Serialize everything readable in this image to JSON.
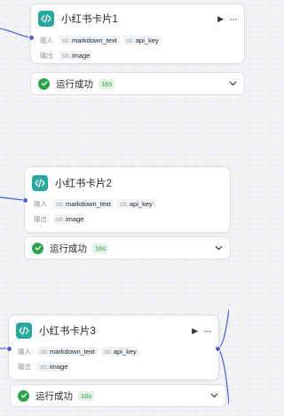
{
  "nodes": [
    {
      "title": "小红书卡片1",
      "input_label": "输入",
      "output_label": "输出",
      "inputs": [
        {
          "type": "str.",
          "name": "markdown_text"
        },
        {
          "type": "str.",
          "name": "api_key"
        }
      ],
      "outputs": [
        {
          "type": "str.",
          "name": "image"
        }
      ],
      "status": "运行成功",
      "duration": "16s"
    },
    {
      "title": "小红书卡片2",
      "input_label": "输入",
      "output_label": "输出",
      "inputs": [
        {
          "type": "str.",
          "name": "markdown_text"
        },
        {
          "type": "str.",
          "name": "api_key"
        }
      ],
      "outputs": [
        {
          "type": "str.",
          "name": "image"
        }
      ],
      "status": "运行成功",
      "duration": "16s"
    },
    {
      "title": "小红书卡片3",
      "input_label": "输入",
      "output_label": "输出",
      "inputs": [
        {
          "type": "str.",
          "name": "markdown_text"
        },
        {
          "type": "str.",
          "name": "api_key"
        }
      ],
      "outputs": [
        {
          "type": "str.",
          "name": "image"
        }
      ],
      "status": "运行成功",
      "duration": "16s"
    }
  ],
  "colors": {
    "accent": "#27a7a0",
    "edge": "#4a5fd8",
    "success": "#2ea44f"
  }
}
